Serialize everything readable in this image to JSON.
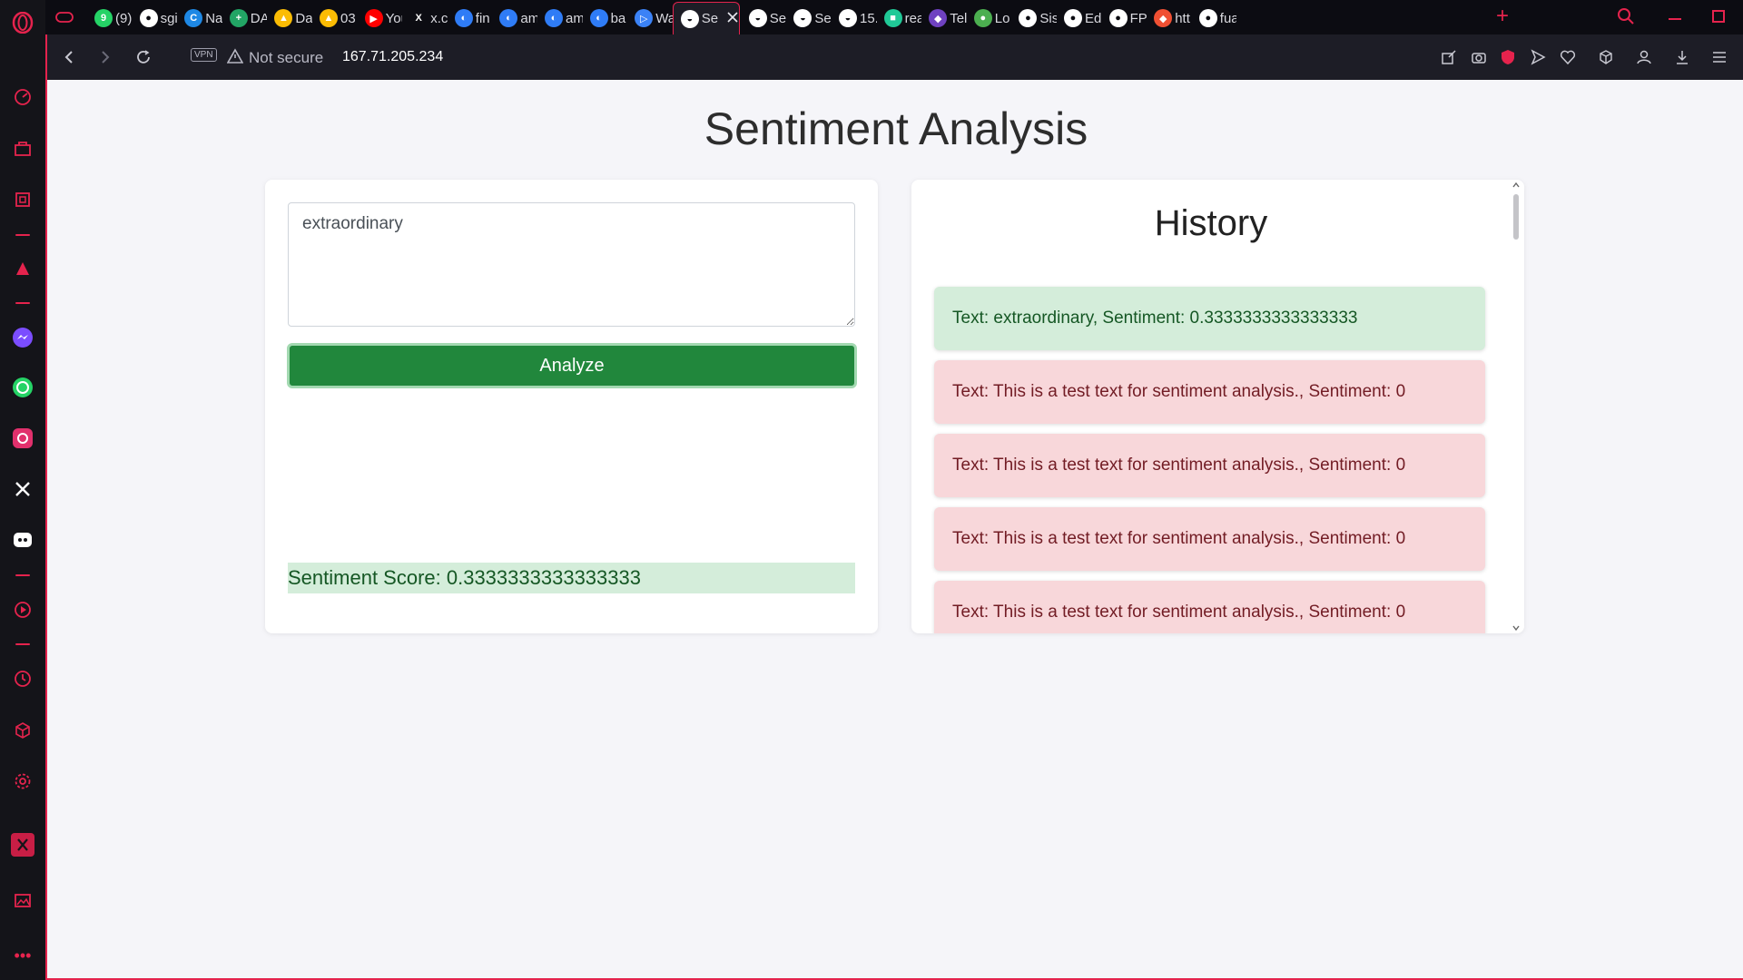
{
  "browser": {
    "tabs": [
      {
        "label": "(9)",
        "color": "#25d366",
        "glyph": "9"
      },
      {
        "label": "sgi",
        "color": "#ffffff",
        "glyph": "●"
      },
      {
        "label": "Na",
        "color": "#1e88e5",
        "glyph": "C"
      },
      {
        "label": "DA",
        "color": "#22a565",
        "glyph": "+"
      },
      {
        "label": "Da",
        "color": "#fbbc04",
        "glyph": "▲"
      },
      {
        "label": "03",
        "color": "#fbbc04",
        "glyph": "▲"
      },
      {
        "label": "You",
        "color": "#ff0000",
        "glyph": "▶"
      },
      {
        "label": "x.c",
        "color": "#0c0c12",
        "glyph": "X"
      },
      {
        "label": "fin",
        "color": "#2f7cf6",
        "glyph": "◐"
      },
      {
        "label": "am",
        "color": "#2f7cf6",
        "glyph": "◐"
      },
      {
        "label": "am",
        "color": "#2f7cf6",
        "glyph": "◐"
      },
      {
        "label": "ba",
        "color": "#2f7cf6",
        "glyph": "◐"
      },
      {
        "label": "Wa",
        "color": "#3b82f6",
        "glyph": "▷"
      },
      {
        "label": "Se",
        "color": "#ffffff",
        "glyph": "◒",
        "active": true
      },
      {
        "label": "Ser",
        "color": "#ffffff",
        "glyph": "◒"
      },
      {
        "label": "Ser",
        "color": "#ffffff",
        "glyph": "◒"
      },
      {
        "label": "15.",
        "color": "#ffffff",
        "glyph": "◒"
      },
      {
        "label": "rea",
        "color": "#20c997",
        "glyph": "■"
      },
      {
        "label": "Tel",
        "color": "#6f42c1",
        "glyph": "◆"
      },
      {
        "label": "Lo",
        "color": "#4caf50",
        "glyph": "●"
      },
      {
        "label": "Sis",
        "color": "#ffffff",
        "glyph": "●"
      },
      {
        "label": "Edi",
        "color": "#ffffff",
        "glyph": "●"
      },
      {
        "label": "FP.",
        "color": "#ffffff",
        "glyph": "●"
      },
      {
        "label": "htt",
        "color": "#f05033",
        "glyph": "◆"
      },
      {
        "label": "fua",
        "color": "#ffffff",
        "glyph": "●"
      }
    ],
    "security_label": "Not secure",
    "url": "167.71.205.234",
    "vpn_label": "VPN"
  },
  "app": {
    "title": "Sentiment Analysis",
    "input_value": "extraordinary",
    "analyze_label": "Analyze",
    "score_text": "Sentiment Score: 0.3333333333333333",
    "history_title": "History",
    "history": [
      {
        "text": "Text: extraordinary, Sentiment: 0.3333333333333333",
        "kind": "pos"
      },
      {
        "text": "Text: This is a test text for sentiment analysis., Sentiment: 0",
        "kind": "neg"
      },
      {
        "text": "Text: This is a test text for sentiment analysis., Sentiment: 0",
        "kind": "neg"
      },
      {
        "text": "Text: This is a test text for sentiment analysis., Sentiment: 0",
        "kind": "neg"
      },
      {
        "text": "Text: This is a test text for sentiment analysis., Sentiment: 0",
        "kind": "neg"
      }
    ]
  },
  "colors": {
    "accent": "#e5234d",
    "analyze_button": "#21873c",
    "positive_bg": "#d4edda",
    "negative_bg": "#f8d7da"
  }
}
